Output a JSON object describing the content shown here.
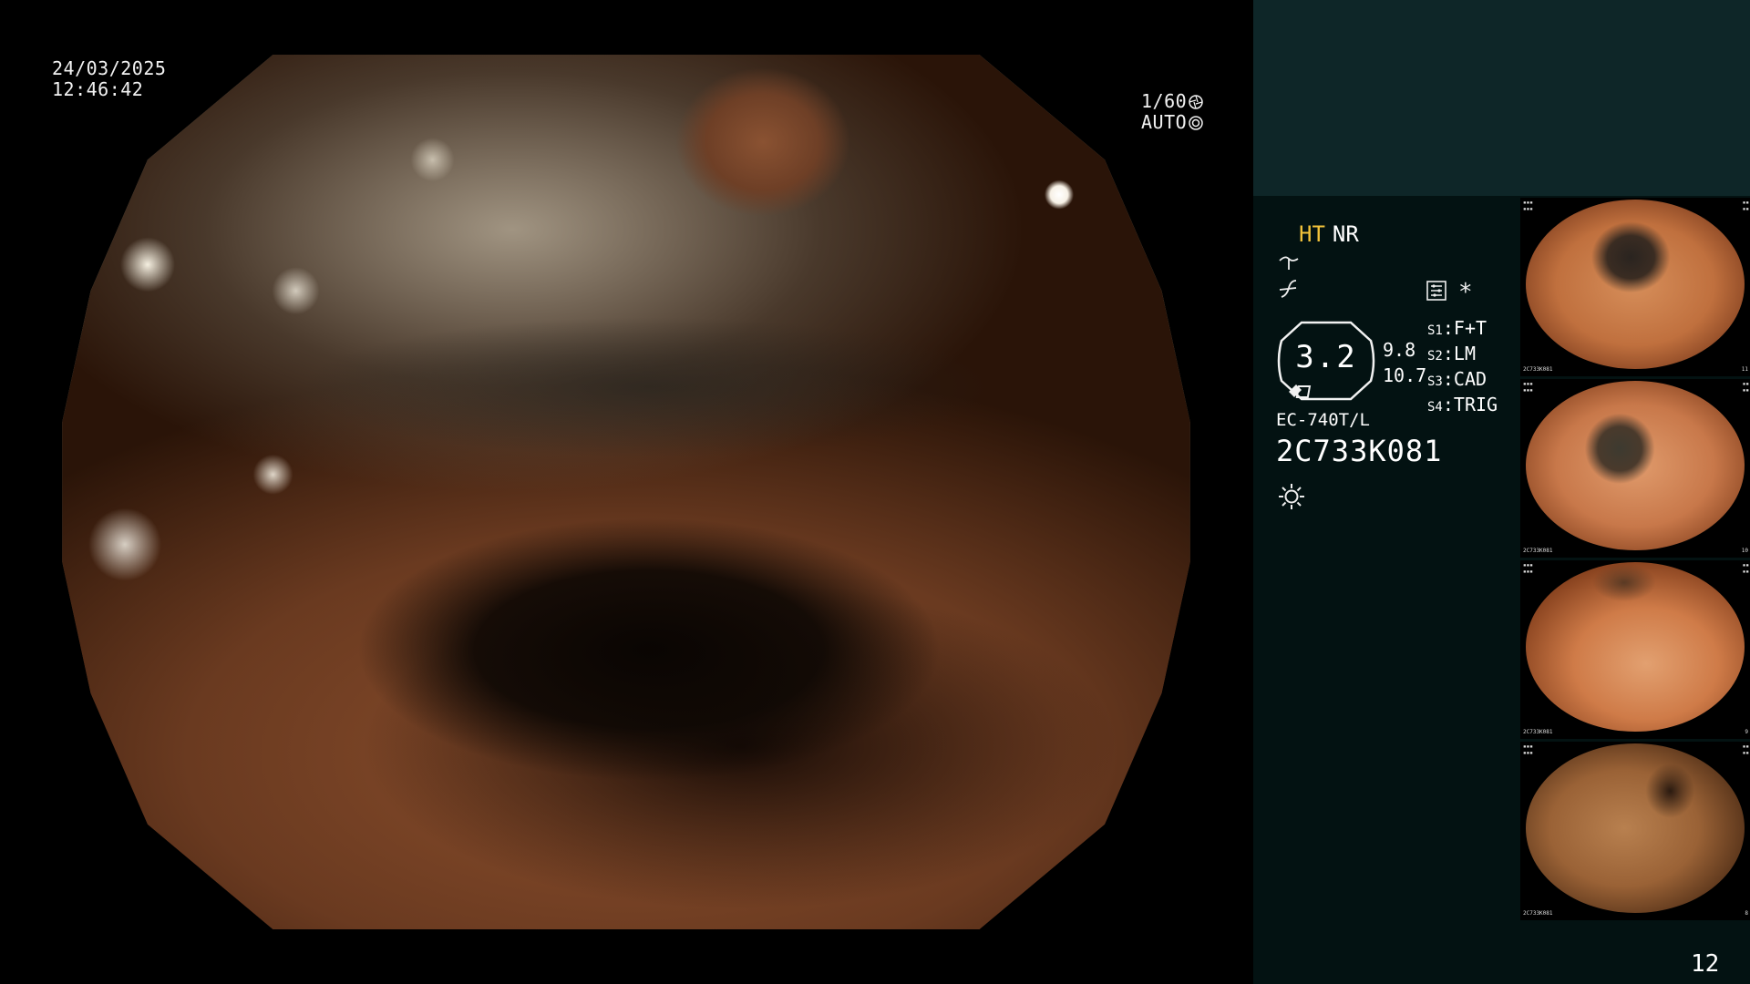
{
  "overlay": {
    "date": "24/03/2025",
    "time": "12:46:42",
    "shutter": "1/60",
    "exposure": "AUTO"
  },
  "panel": {
    "mode_ht": "HT",
    "mode_nr": "NR",
    "gauge_value": "3.2",
    "gauge_side_top": "9.8",
    "gauge_side_bottom": "10.7",
    "asterisk": "*",
    "slots": [
      {
        "key": "S1",
        "value": "F+T"
      },
      {
        "key": "S2",
        "value": "LM"
      },
      {
        "key": "S3",
        "value": "CAD"
      },
      {
        "key": "S4",
        "value": "TRIG"
      }
    ],
    "model": "EC-740T/L",
    "serial": "2C733K081",
    "page_number": "12"
  },
  "thumbnails": [
    {
      "label": "2C733K081",
      "index": "11"
    },
    {
      "label": "2C733K081",
      "index": "10"
    },
    {
      "label": "2C733K081",
      "index": "9"
    },
    {
      "label": "2C733K081",
      "index": "8"
    }
  ],
  "icons": {
    "shutter_icon": "aperture-icon",
    "exposure_icon": "exposure-icon",
    "brightness_icon": "sun-icon",
    "curve_icon_1": "enhance-curve-icon",
    "curve_icon_2": "color-curve-icon",
    "settings_icon": "menu-settings-icon"
  },
  "colors": {
    "ht_accent": "#f2c23a",
    "panel_bg": "#031212",
    "panel_top_bg": "#0e2628"
  }
}
